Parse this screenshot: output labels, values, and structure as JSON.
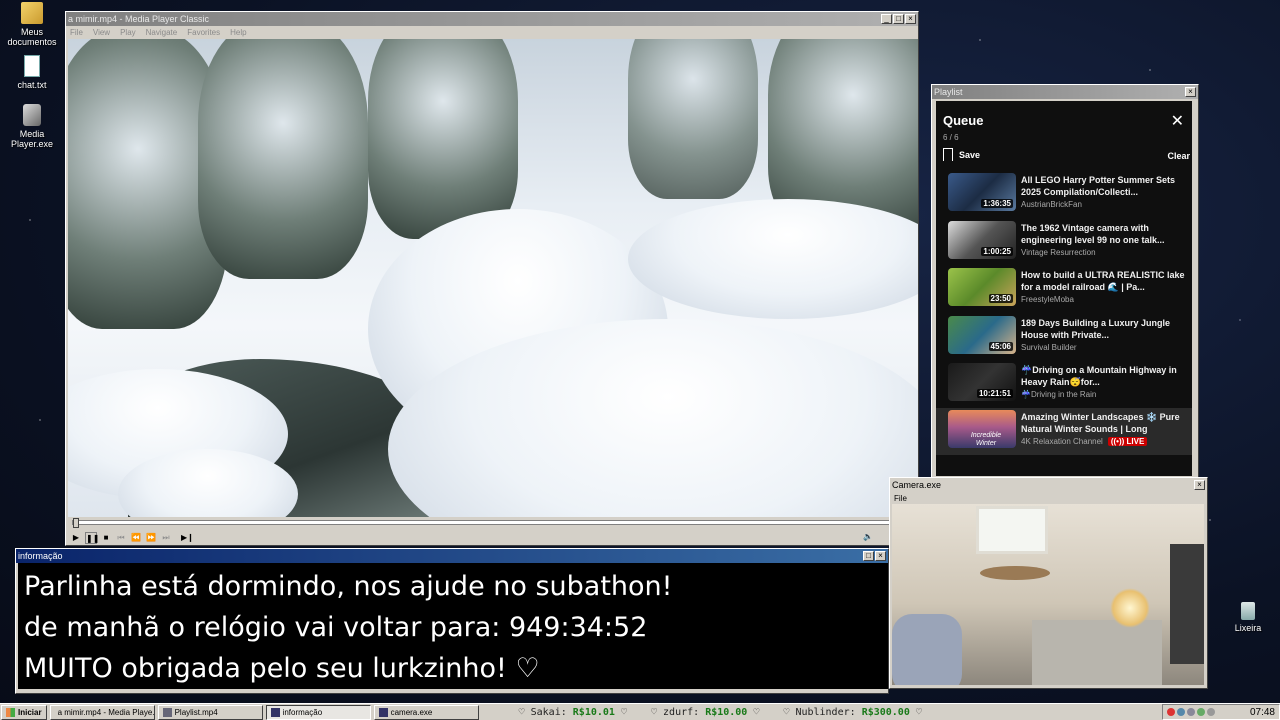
{
  "desktop": {
    "icons": [
      {
        "label": "Meus documentos"
      },
      {
        "label": "chat.txt"
      },
      {
        "label": "Media Player.exe"
      },
      {
        "label": "Lixeira"
      }
    ]
  },
  "player": {
    "title": "a mimir.mp4 - Media Player Classic",
    "menu": [
      "File",
      "View",
      "Play",
      "Navigate",
      "Favorites",
      "Help"
    ],
    "progress": 0.0
  },
  "playlist_window": {
    "title": "Playlist",
    "heading": "Queue",
    "count": "6 / 6",
    "save_label": "Save",
    "clear_label": "Clear",
    "items": [
      {
        "title": "All LEGO Harry Potter Summer Sets 2025 Compilation/Collecti...",
        "channel": "AustrianBrickFan",
        "duration": "1:36:35"
      },
      {
        "title": "The 1962 Vintage camera with engineering level 99 no one talk...",
        "channel": "Vintage Resurrection",
        "duration": "1:00:25"
      },
      {
        "title": "How to build a ULTRA REALISTIC lake for a model railroad 🌊 | Pa...",
        "channel": "FreestyleMoba",
        "duration": "23:50"
      },
      {
        "title": "189 Days Building a Luxury Jungle House with Private...",
        "channel": "Survival Builder",
        "duration": "45:06"
      },
      {
        "title": "☔Driving on a Mountain Highway in Heavy Rain😴for...",
        "channel": "☔Driving in the Rain",
        "duration": "10:21:51"
      },
      {
        "title": "Amazing Winter Landscapes ❄️ Pure Natural Winter Sounds | Long Relaxing...",
        "channel": "4K Relaxation Channel",
        "duration": "",
        "live": "LIVE",
        "thumb_text": "Incredible Winter"
      }
    ]
  },
  "info_window": {
    "title": "informação",
    "lines": [
      "Parlinha está dormindo, nos ajude no subathon!",
      "de manhã o relógio vai voltar para:  949:34:52",
      "MUITO obrigada pelo seu lurkzinho! ♡"
    ]
  },
  "camera_window": {
    "title": "Camera.exe",
    "menu": [
      "File"
    ]
  },
  "taskbar": {
    "start_label": "Iniciar",
    "tasks": [
      {
        "label": "a mimir.mp4 - Media Playe..."
      },
      {
        "label": "Playlist.mp4"
      },
      {
        "label": "informação"
      },
      {
        "label": "camera.exe"
      }
    ],
    "donations": [
      {
        "name": "Sakai:",
        "amount": "R$10.01"
      },
      {
        "name": "zdurf:",
        "amount": "R$10.00"
      },
      {
        "name": "Nublinder:",
        "amount": "R$300.00"
      }
    ],
    "clock": "07:48"
  }
}
